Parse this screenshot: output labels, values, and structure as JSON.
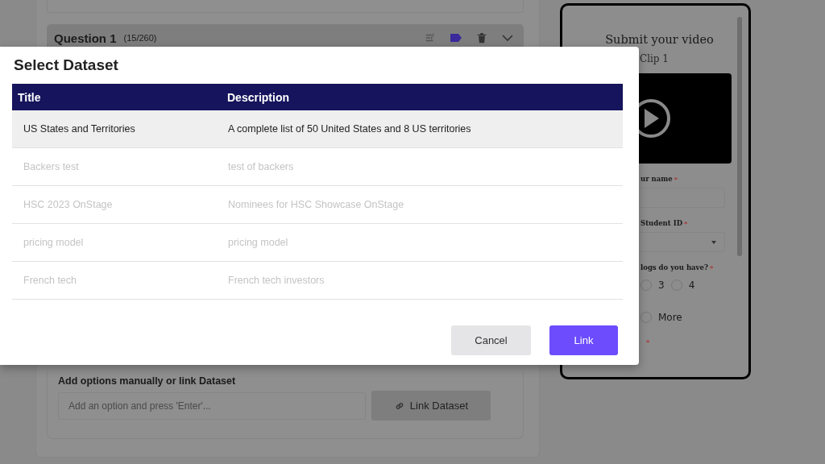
{
  "editor": {
    "question": {
      "title": "Question 1",
      "count": "(15/260)"
    },
    "options": {
      "label": "Add options manually or link Dataset",
      "placeholder": "Add an option and press 'Enter'...",
      "link_button": "Link Dataset"
    }
  },
  "preview": {
    "title": "Submit your video",
    "subtitle": "Clip 1",
    "name_label": "ur name",
    "id_label": "Student ID",
    "dogs_label": "logs do you have?",
    "required_mark": "*",
    "choices": [
      {
        "label": "3",
        "selected": false
      },
      {
        "label": "4",
        "selected": false
      },
      {
        "label": "More",
        "selected": false
      }
    ]
  },
  "dialog": {
    "title": "Select Dataset",
    "columns": [
      "Title",
      "Description"
    ],
    "rows": [
      {
        "title": "US States and Territories",
        "description": "A complete list of 50 United States and 8 US territories",
        "selected": true,
        "blurred": false
      },
      {
        "title": "Backers test",
        "description": "test of backers",
        "selected": false,
        "blurred": true
      },
      {
        "title": "HSC 2023 OnStage",
        "description": "Nominees for HSC Showcase OnStage",
        "selected": false,
        "blurred": true
      },
      {
        "title": "pricing model",
        "description": "pricing model",
        "selected": false,
        "blurred": true
      },
      {
        "title": "French tech",
        "description": "French tech investors",
        "selected": false,
        "blurred": true
      }
    ],
    "buttons": [
      {
        "label": "Cancel",
        "kind": "secondary"
      },
      {
        "label": "Link",
        "kind": "primary"
      }
    ]
  }
}
